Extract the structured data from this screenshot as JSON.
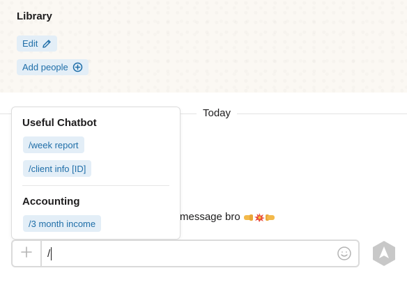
{
  "channel": {
    "title": "Library",
    "edit_label": "Edit",
    "add_people_label": "Add people"
  },
  "divider": {
    "date_label": "Today"
  },
  "message": {
    "visible_text": "message bro"
  },
  "command_popup": {
    "sections": [
      {
        "title": "Useful Chatbot",
        "commands": [
          "/week report",
          "/client info [ID]"
        ]
      },
      {
        "title": "Accounting",
        "commands": [
          "/3 month income"
        ]
      }
    ]
  },
  "composer": {
    "input_value": "/"
  },
  "colors": {
    "chip_bg": "#e3eef7",
    "chip_text": "#1f6ea8",
    "header_bg": "#fbf8f3",
    "border": "#dadada",
    "send_icon": "#c8c8c8"
  },
  "icons": {
    "edit": "pencil-icon",
    "add_people": "plus-circle-icon",
    "composer_add": "plus-icon",
    "composer_emoji": "smiley-icon",
    "send": "send-icon"
  }
}
